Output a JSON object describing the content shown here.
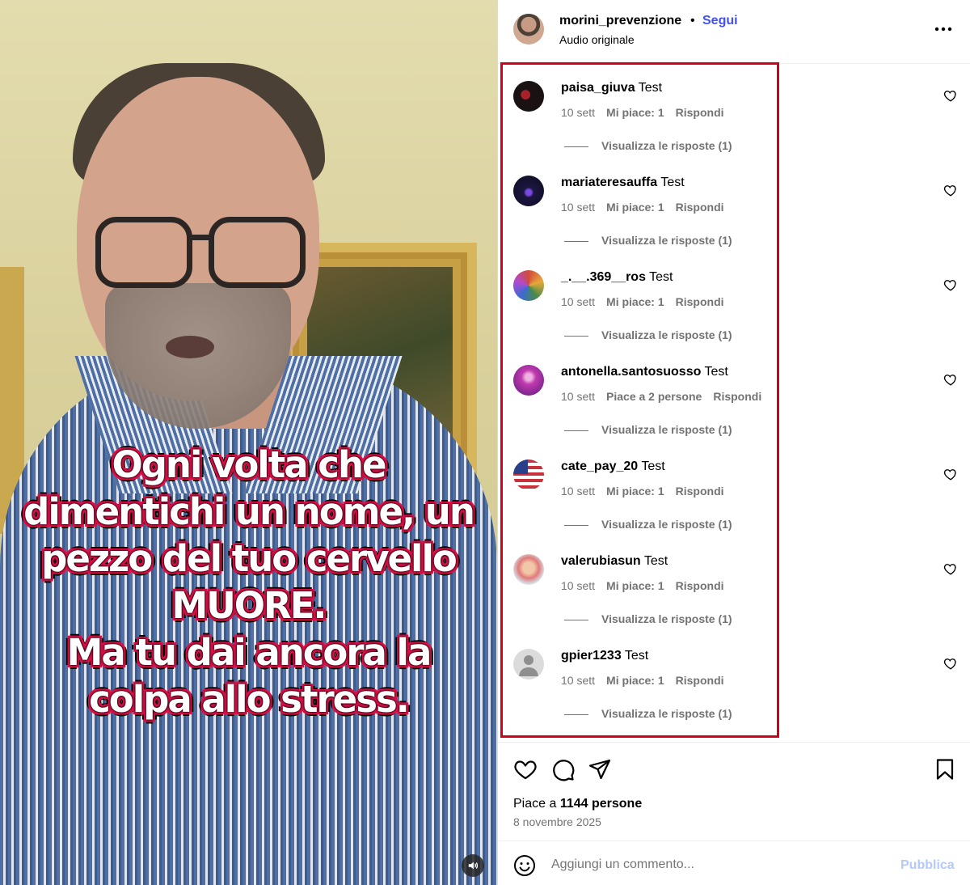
{
  "video": {
    "overlay_lines": [
      "Ogni volta che",
      "dimentichi un nome, un",
      "pezzo del tuo cervello",
      "MUORE.",
      "Ma tu dai ancora la",
      "colpa allo stress."
    ],
    "volume_icon": "speaker-icon"
  },
  "header": {
    "username": "morini_prevenzione",
    "separator": "•",
    "follow_label": "Segui",
    "audio_label": "Audio originale",
    "more_icon": "more-horizontal-icon"
  },
  "comments": [
    {
      "username": "paisa_giuva",
      "text": "Test",
      "time": "10 sett",
      "likes": "Mi piace: 1",
      "reply": "Rispondi",
      "view_replies": "Visualizza le risposte (1)"
    },
    {
      "username": "mariateresauffa",
      "text": "Test",
      "time": "10 sett",
      "likes": "Mi piace: 1",
      "reply": "Rispondi",
      "view_replies": "Visualizza le risposte (1)"
    },
    {
      "username": "_.__.369__ros",
      "text": "Test",
      "time": "10 sett",
      "likes": "Mi piace: 1",
      "reply": "Rispondi",
      "view_replies": "Visualizza le risposte (1)"
    },
    {
      "username": "antonella.santosuosso",
      "text": "Test",
      "time": "10 sett",
      "likes": "Piace a 2 persone",
      "reply": "Rispondi",
      "view_replies": "Visualizza le risposte (1)"
    },
    {
      "username": "cate_pay_20",
      "text": "Test",
      "time": "10 sett",
      "likes": "Mi piace: 1",
      "reply": "Rispondi",
      "view_replies": "Visualizza le risposte (1)"
    },
    {
      "username": "valerubiasun",
      "text": "Test",
      "time": "10 sett",
      "likes": "Mi piace: 1",
      "reply": "Rispondi",
      "view_replies": "Visualizza le risposte (1)"
    },
    {
      "username": "gpier1233",
      "text": "Test",
      "time": "10 sett",
      "likes": "Mi piace: 1",
      "reply": "Rispondi",
      "view_replies": "Visualizza le risposte (1)"
    }
  ],
  "actions": {
    "likes_prefix": "Piace a ",
    "likes_count": "1144 persone",
    "date": "8 novembre 2025"
  },
  "compose": {
    "placeholder": "Aggiungi un commento...",
    "publish_label": "Pubblica"
  },
  "colors": {
    "accent": "#4150f7",
    "highlight_border": "#d0021b",
    "muted_text": "#737373",
    "publish_disabled": "#b3c8fb"
  }
}
